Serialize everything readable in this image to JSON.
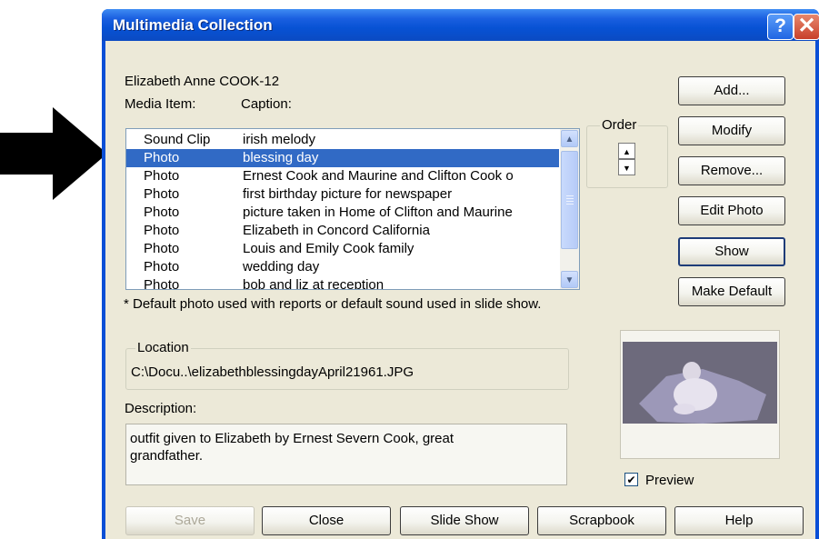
{
  "window": {
    "title": "Multimedia Collection",
    "help_glyph": "?",
    "close_glyph": "✕"
  },
  "person_name": "Elizabeth Anne COOK-12",
  "list": {
    "header_media": "Media Item:",
    "header_caption": "Caption:",
    "rows": [
      {
        "media": "Sound Clip",
        "caption": "irish melody"
      },
      {
        "media": "Photo",
        "caption": "blessing day"
      },
      {
        "media": "Photo",
        "caption": "Ernest Cook and Maurine and Clifton Cook o"
      },
      {
        "media": "Photo",
        "caption": "first birthday picture for newspaper"
      },
      {
        "media": "Photo",
        "caption": "picture taken in Home of Clifton and Maurine"
      },
      {
        "media": "Photo",
        "caption": "Elizabeth in Concord California"
      },
      {
        "media": "Photo",
        "caption": "Louis and Emily Cook family"
      },
      {
        "media": "Photo",
        "caption": "wedding day"
      },
      {
        "media": "Photo",
        "caption": "bob and liz at reception"
      }
    ],
    "selected_index": 1
  },
  "order": {
    "label": "Order",
    "up_glyph": "▲",
    "down_glyph": "▼"
  },
  "right_buttons": {
    "add": "Add...",
    "modify": "Modify",
    "remove": "Remove...",
    "edit_photo": "Edit Photo",
    "show": "Show",
    "make_default": "Make Default"
  },
  "footnote": "* Default photo used with reports or default sound used in slide show.",
  "location": {
    "label": "Location",
    "value": "C:\\Docu..\\elizabethblessingdayApril21961.JPG"
  },
  "description": {
    "label": "Description:",
    "value": "outfit given to Elizabeth by Ernest Severn Cook, great grandfather."
  },
  "preview": {
    "label": "Preview",
    "checked": true,
    "check_glyph": "✔"
  },
  "bottom_buttons": {
    "save": "Save",
    "close": "Close",
    "slide_show": "Slide Show",
    "scrapbook": "Scrapbook",
    "help": "Help"
  },
  "colors": {
    "title_bar": "#0a4fd6",
    "selection": "#316ac5",
    "dialog_bg": "#ece9d8"
  }
}
